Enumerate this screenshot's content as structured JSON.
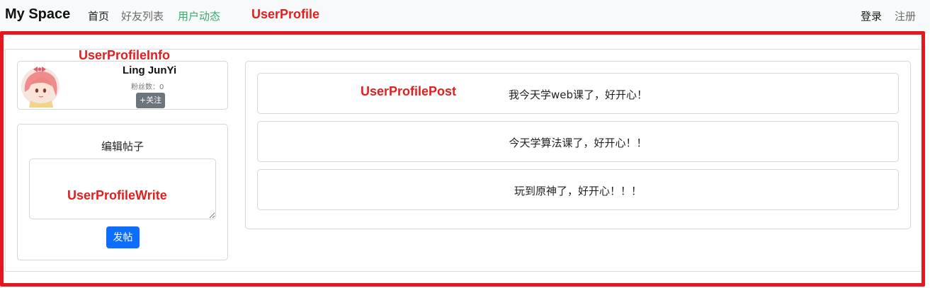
{
  "navbar": {
    "brand": "My Space",
    "links": {
      "home": "首页",
      "friends": "好友列表",
      "feed": "用户动态",
      "login": "登录",
      "register": "注册"
    },
    "active_color": "#3aa96b"
  },
  "annotations": {
    "profile": "UserProfile",
    "info": "UserProfileInfo",
    "post": "UserProfilePost",
    "write": "UserProfileWrite",
    "color": "#e02020"
  },
  "profile_info": {
    "username": "Ling JunYi",
    "fans_label": "粉丝数：",
    "fans_count": "0",
    "follow_label": "+关注",
    "avatar_icon": "anime-girl-avatar-icon"
  },
  "write": {
    "title": "编辑帖子",
    "textarea_value": "",
    "submit_label": "发帖"
  },
  "posts": [
    {
      "text": "我今天学web课了，好开心！"
    },
    {
      "text": "今天学算法课了，好开心！！"
    },
    {
      "text": "玩到原神了，好开心！！！"
    }
  ]
}
